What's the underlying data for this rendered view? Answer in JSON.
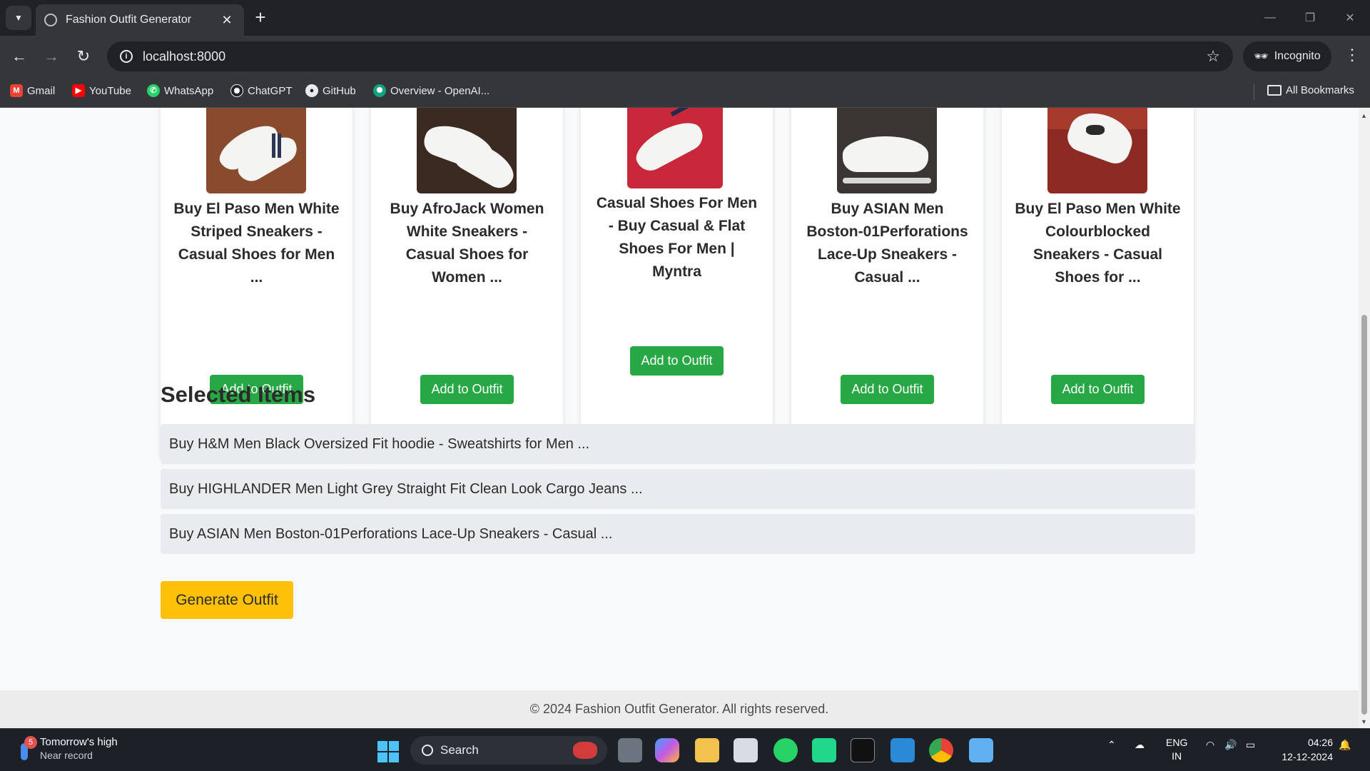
{
  "browser": {
    "tab_title": "Fashion Outfit Generator",
    "tab_close": "✕",
    "new_tab": "+",
    "url": "localhost:8000",
    "incognito_label": "Incognito",
    "bookmarks": [
      {
        "label": "Gmail",
        "icon": "gmail-icon",
        "color": "#ea4335"
      },
      {
        "label": "YouTube",
        "icon": "youtube-icon",
        "color": "#ff0000"
      },
      {
        "label": "WhatsApp",
        "icon": "whatsapp-icon",
        "color": "#25d366"
      },
      {
        "label": "ChatGPT",
        "icon": "chatgpt-icon",
        "color": "#202124"
      },
      {
        "label": "GitHub",
        "icon": "github-icon",
        "color": "#202124"
      },
      {
        "label": "Overview - OpenAI...",
        "icon": "openai-icon",
        "color": "#10a37f"
      }
    ],
    "all_bookmarks": "All Bookmarks"
  },
  "products": [
    {
      "name": "Buy El Paso Men White Striped Sneakers - Casual Shoes for Men ...",
      "button": "Add to Outfit",
      "image_bg": "#8a4a2e"
    },
    {
      "name": "Buy AfroJack Women White Sneakers - Casual Shoes for Women ...",
      "button": "Add to Outfit",
      "image_bg": "#3a2a22"
    },
    {
      "name": "Casual Shoes For Men - Buy Casual & Flat Shoes For Men | Myntra",
      "button": "Add to Outfit",
      "image_bg": "#c8283a"
    },
    {
      "name": "Buy ASIAN Men Boston-01Perforations Lace-Up Sneakers - Casual ...",
      "button": "Add to Outfit",
      "image_bg": "#3b3633"
    },
    {
      "name": "Buy El Paso Men White Colourblocked Sneakers - Casual Shoes for ...",
      "button": "Add to Outfit",
      "image_bg": "#8e2a24"
    }
  ],
  "selected": {
    "heading": "Selected Items",
    "items": [
      "Buy H&M Men Black Oversized Fit hoodie - Sweatshirts for Men ...",
      "Buy HIGHLANDER Men Light Grey Straight Fit Clean Look Cargo Jeans ...",
      "Buy ASIAN Men Boston-01Perforations Lace-Up Sneakers - Casual ..."
    ]
  },
  "generate_button": "Generate Outfit",
  "footer": "© 2024 Fashion Outfit Generator. All rights reserved.",
  "colors": {
    "add_button": "#28a745",
    "generate_button": "#ffc107",
    "selected_item_bg": "#e9ecef"
  },
  "taskbar": {
    "weather_badge": "5",
    "weather_title": "Tomorrow's high",
    "weather_sub": "Near record",
    "search_label": "Search",
    "lang_top": "ENG",
    "lang_bottom": "IN",
    "time": "04:26",
    "date": "12-12-2024"
  }
}
